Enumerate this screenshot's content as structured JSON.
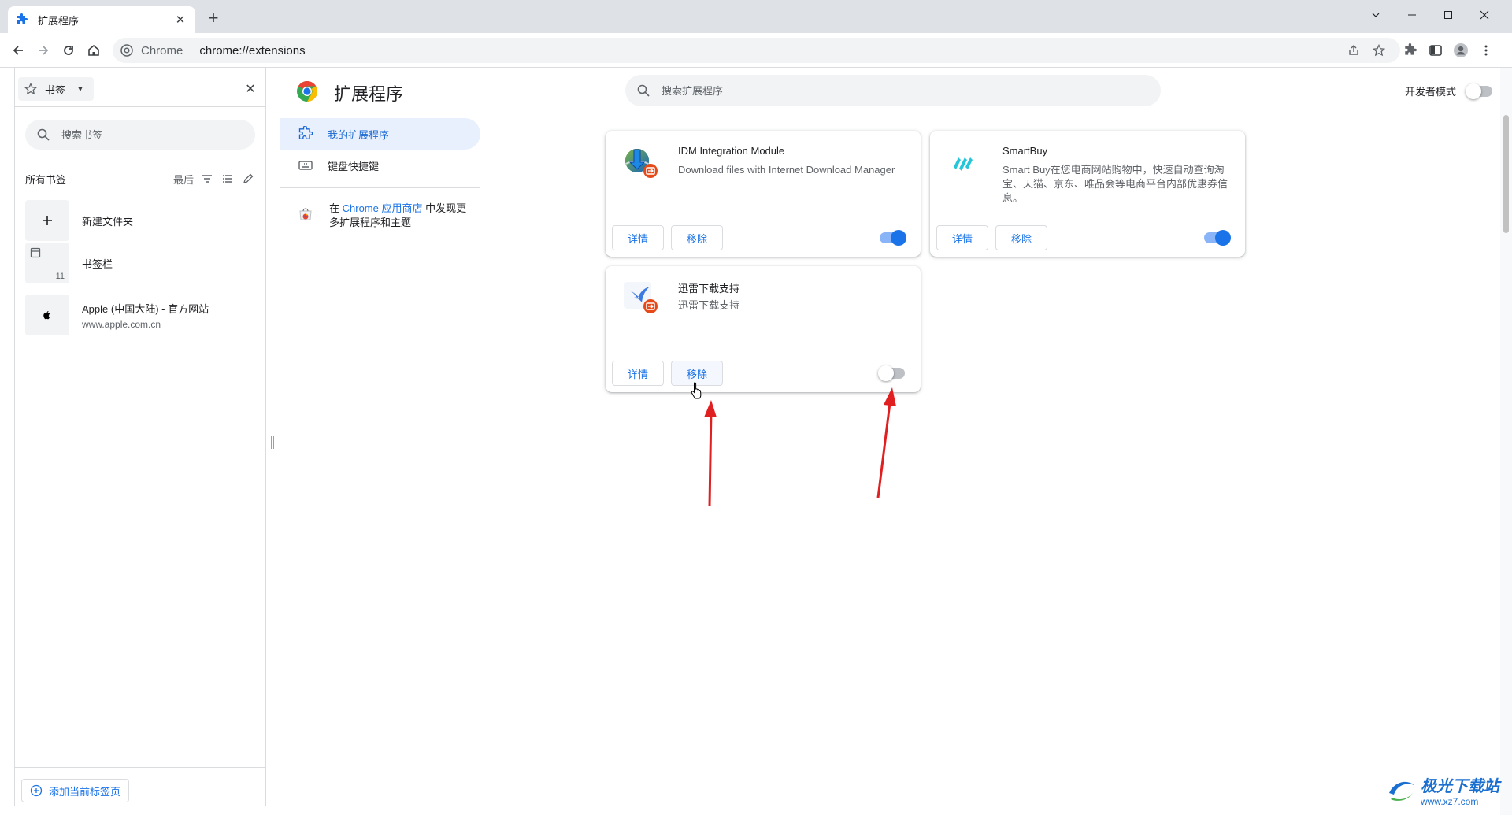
{
  "browser": {
    "tab_title": "扩展程序",
    "omnibox": {
      "site_name": "Chrome",
      "url": "chrome://extensions"
    }
  },
  "bookmarks_panel": {
    "selector_label": "书签",
    "search_placeholder": "搜索书签",
    "all_title": "所有书签",
    "sort_label": "最后",
    "items": [
      {
        "title": "新建文件夹",
        "subtitle": ""
      },
      {
        "title": "书签栏",
        "subtitle": "",
        "count": "11"
      },
      {
        "title": "Apple (中国大陆) - 官方网站",
        "subtitle": "www.apple.com.cn"
      }
    ],
    "add_button": "添加当前标签页"
  },
  "extensions_page": {
    "title": "扩展程序",
    "search_placeholder": "搜索扩展程序",
    "dev_mode_label": "开发者模式",
    "nav": {
      "my_extensions": "我的扩展程序",
      "shortcuts": "键盘快捷键"
    },
    "store": {
      "prefix": "在 ",
      "link": "Chrome 应用商店",
      "suffix": " 中发现更多扩展程序和主题"
    },
    "cards": [
      {
        "name": "IDM Integration Module",
        "description": "Download files with Internet Download Manager",
        "details": "详情",
        "remove": "移除",
        "enabled": true
      },
      {
        "name": "SmartBuy",
        "description": "Smart Buy在您电商网站购物中，快速自动查询淘宝、天猫、京东、唯品会等电商平台内部优惠券信息。",
        "details": "详情",
        "remove": "移除",
        "enabled": true
      },
      {
        "name": "迅雷下载支持",
        "description": "迅雷下载支持",
        "details": "详情",
        "remove": "移除",
        "enabled": false
      }
    ]
  },
  "watermark": {
    "brand": "极光下载站",
    "url": "www.xz7.com"
  },
  "colors": {
    "accent": "#1a73e8",
    "annotation_arrow": "#e02020",
    "toggle_on": "#1a73e8"
  }
}
